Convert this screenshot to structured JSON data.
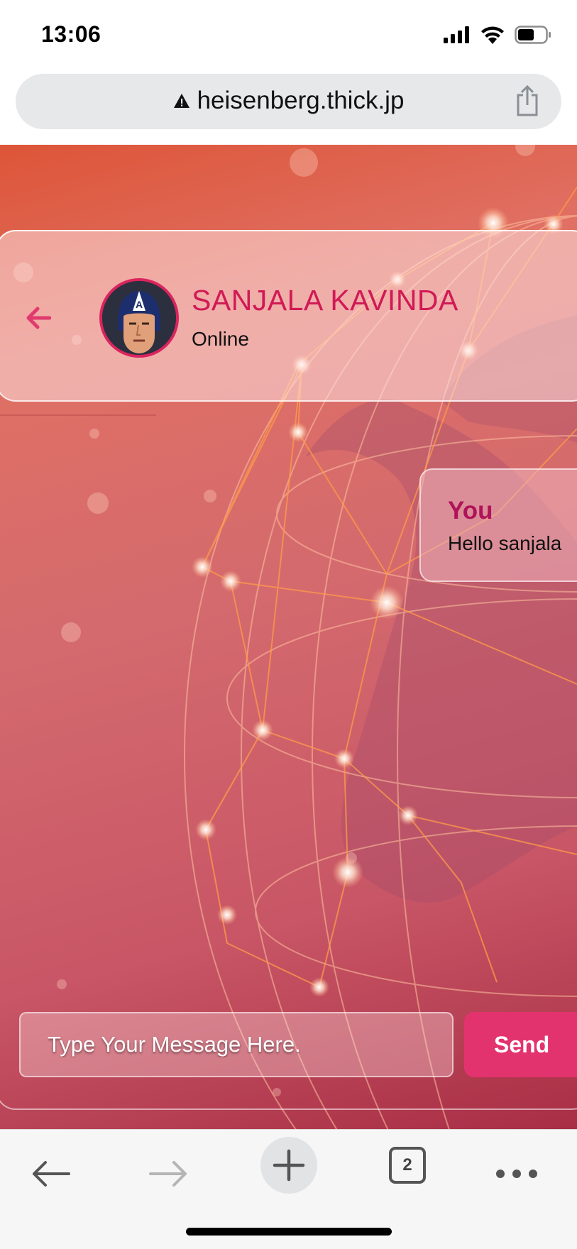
{
  "status_bar": {
    "time": "13:06",
    "icons": [
      "signal-icon",
      "wifi-icon",
      "battery-icon"
    ]
  },
  "browser": {
    "url": "heisenberg.thick.jp",
    "warning_icon": "warning-icon",
    "share_icon": "share-icon",
    "toolbar": {
      "back_icon": "back-arrow-icon",
      "forward_icon": "forward-arrow-icon",
      "new_tab_icon": "plus-icon",
      "tab_count": "2",
      "more_icon": "more-icon"
    }
  },
  "chat": {
    "contact": {
      "name": "SANJALA KAVINDA",
      "status": "Online"
    },
    "messages": [
      {
        "sender": "You",
        "text": "Hello sanjala"
      }
    ],
    "input_placeholder": "Type Your Message Here.",
    "send_label": "Send"
  },
  "colors": {
    "accent": "#e3336e",
    "name_color": "#d01a55",
    "sender_color": "#b0135a"
  }
}
